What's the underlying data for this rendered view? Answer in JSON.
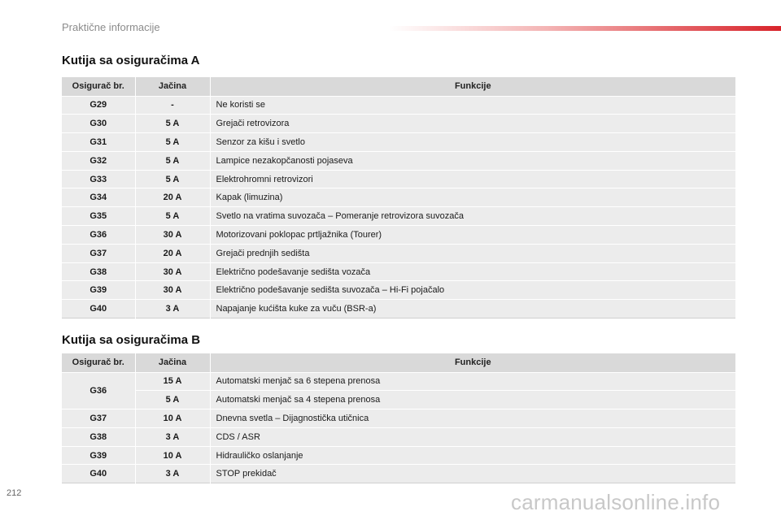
{
  "header": {
    "title": "Praktične informacije"
  },
  "section_a": {
    "title": "Kutija sa osiguračima A",
    "columns": [
      "Osigurač br.",
      "Jačina",
      "Funkcije"
    ],
    "rows": [
      {
        "fuse": "G29",
        "amp": "-",
        "func": "Ne koristi se"
      },
      {
        "fuse": "G30",
        "amp": "5 A",
        "func": "Grejači retrovizora"
      },
      {
        "fuse": "G31",
        "amp": "5 A",
        "func": "Senzor za kišu i svetlo"
      },
      {
        "fuse": "G32",
        "amp": "5 A",
        "func": "Lampice nezakopčanosti pojaseva"
      },
      {
        "fuse": "G33",
        "amp": "5 A",
        "func": "Elektrohromni retrovizori"
      },
      {
        "fuse": "G34",
        "amp": "20 A",
        "func": "Kapak (limuzina)"
      },
      {
        "fuse": "G35",
        "amp": "5 A",
        "func": "Svetlo na vratima suvozača – Pomeranje retrovizora suvozača"
      },
      {
        "fuse": "G36",
        "amp": "30 A",
        "func": "Motorizovani poklopac prtljažnika (Tourer)"
      },
      {
        "fuse": "G37",
        "amp": "20 A",
        "func": "Grejači prednjih sedišta"
      },
      {
        "fuse": "G38",
        "amp": "30 A",
        "func": "Električno podešavanje sedišta vozača"
      },
      {
        "fuse": "G39",
        "amp": "30 A",
        "func": "Električno podešavanje sedišta suvozača – Hi-Fi pojačalo"
      },
      {
        "fuse": "G40",
        "amp": "3 A",
        "func": "Napajanje kućišta kuke za vuču (BSR-a)"
      }
    ]
  },
  "section_b": {
    "title": "Kutija sa osiguračima B",
    "columns": [
      "Osigurač br.",
      "Jačina",
      "Funkcije"
    ],
    "rows": [
      {
        "fuse": "G36",
        "amp": "15 A",
        "func": "Automatski menjač sa 6 stepena prenosa"
      },
      {
        "fuse": "",
        "amp": "5 A",
        "func": "Automatski menjač sa 4 stepena prenosa"
      },
      {
        "fuse": "G37",
        "amp": "10 A",
        "func": "Dnevna svetla – Dijagnostička utičnica"
      },
      {
        "fuse": "G38",
        "amp": "3 A",
        "func": "CDS / ASR"
      },
      {
        "fuse": "G39",
        "amp": "10 A",
        "func": "Hidrauličko oslanjanje"
      },
      {
        "fuse": "G40",
        "amp": "3 A",
        "func": "STOP prekidač"
      }
    ]
  },
  "footer": {
    "page_number": "212",
    "watermark": "carmanualsonline.info"
  }
}
